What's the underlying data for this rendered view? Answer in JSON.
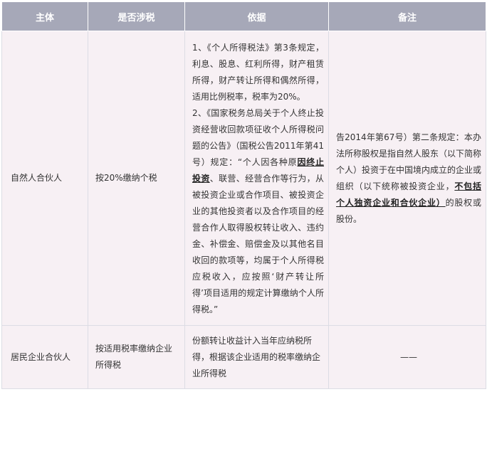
{
  "table": {
    "headers": [
      "主体",
      "是否涉税",
      "依据",
      "备注"
    ],
    "rows": [
      {
        "subject": "自然人合伙人",
        "taxable": "按20%缴纳个税",
        "basis_item1": "1、《个人所得税法》第3条规定，利息、股息、红利所得，财产租赁所得，财产转让所得和偶然所得，适用比例税率，税率为20%。",
        "basis_item2_a": "2、《国家税务总局关于个人终止投资经营收回款项征收个人所得税问题的公告》（国税公告2011年第41号）规定：“个人因各种原",
        "basis_item2_em": "因终止投资",
        "basis_item2_b": "、联营、经营合作等行为，从被投资企业或合作项目、被投资企业的其他投资者以及合作项目的经营合作人取得股权转让收入、违约金、补偿金、赔偿金及以其他名目收回的款项等，均属于个人所得税应税收入，应按照‘财产转让所得’项目适用的规定计算缴纳个人所得税。”",
        "note_a": "告2014年第67号）第二条规定：本办法所称股权是指自然人股东（以下简称个人）投资于在中国境内成立的企业或组织（以下统称被投资企业，",
        "note_em": "不包括个人独资企业和合伙企业）",
        "note_b": "的股权或股份。"
      },
      {
        "subject": "居民企业合伙人",
        "taxable": "按适用税率缴纳企业所得税",
        "basis": "份额转让收益计入当年应纳税所得，根据该企业适用的税率缴纳企业所得税",
        "note": "——"
      }
    ]
  }
}
